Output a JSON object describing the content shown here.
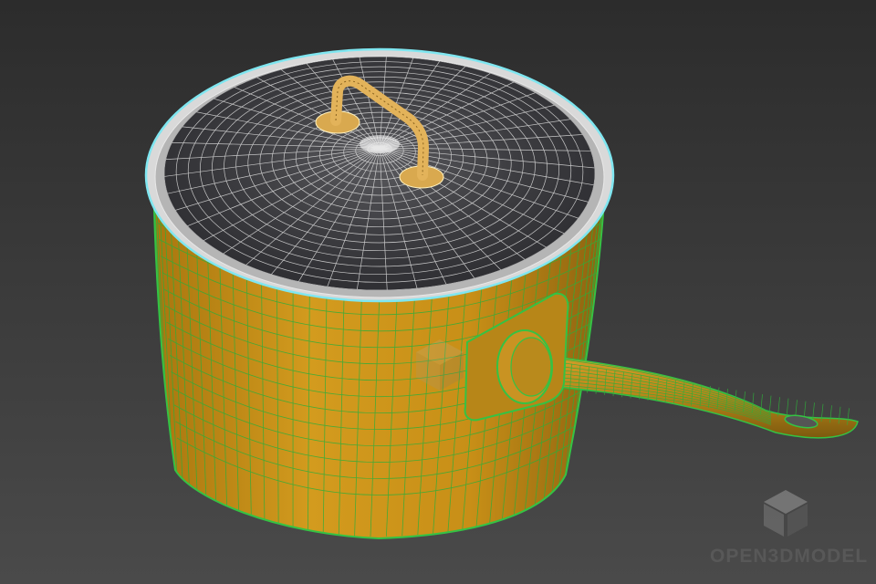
{
  "scene": {
    "subject": "cooking-pot-with-lid-wireframe",
    "background_top": "#2c2c2c",
    "background_bottom": "#4a4a4a",
    "pot_color": "#c9921a",
    "pot_wire_color": "#2fae3a",
    "lid_color": "#3a3a3d",
    "lid_wire_color": "#d8d8d8",
    "rim_highlight_color": "#7fe6f0",
    "knob_color": "#d9a94f"
  },
  "watermark": {
    "icon": "cube-logo-icon",
    "text": "OPEN3DMODEL"
  }
}
